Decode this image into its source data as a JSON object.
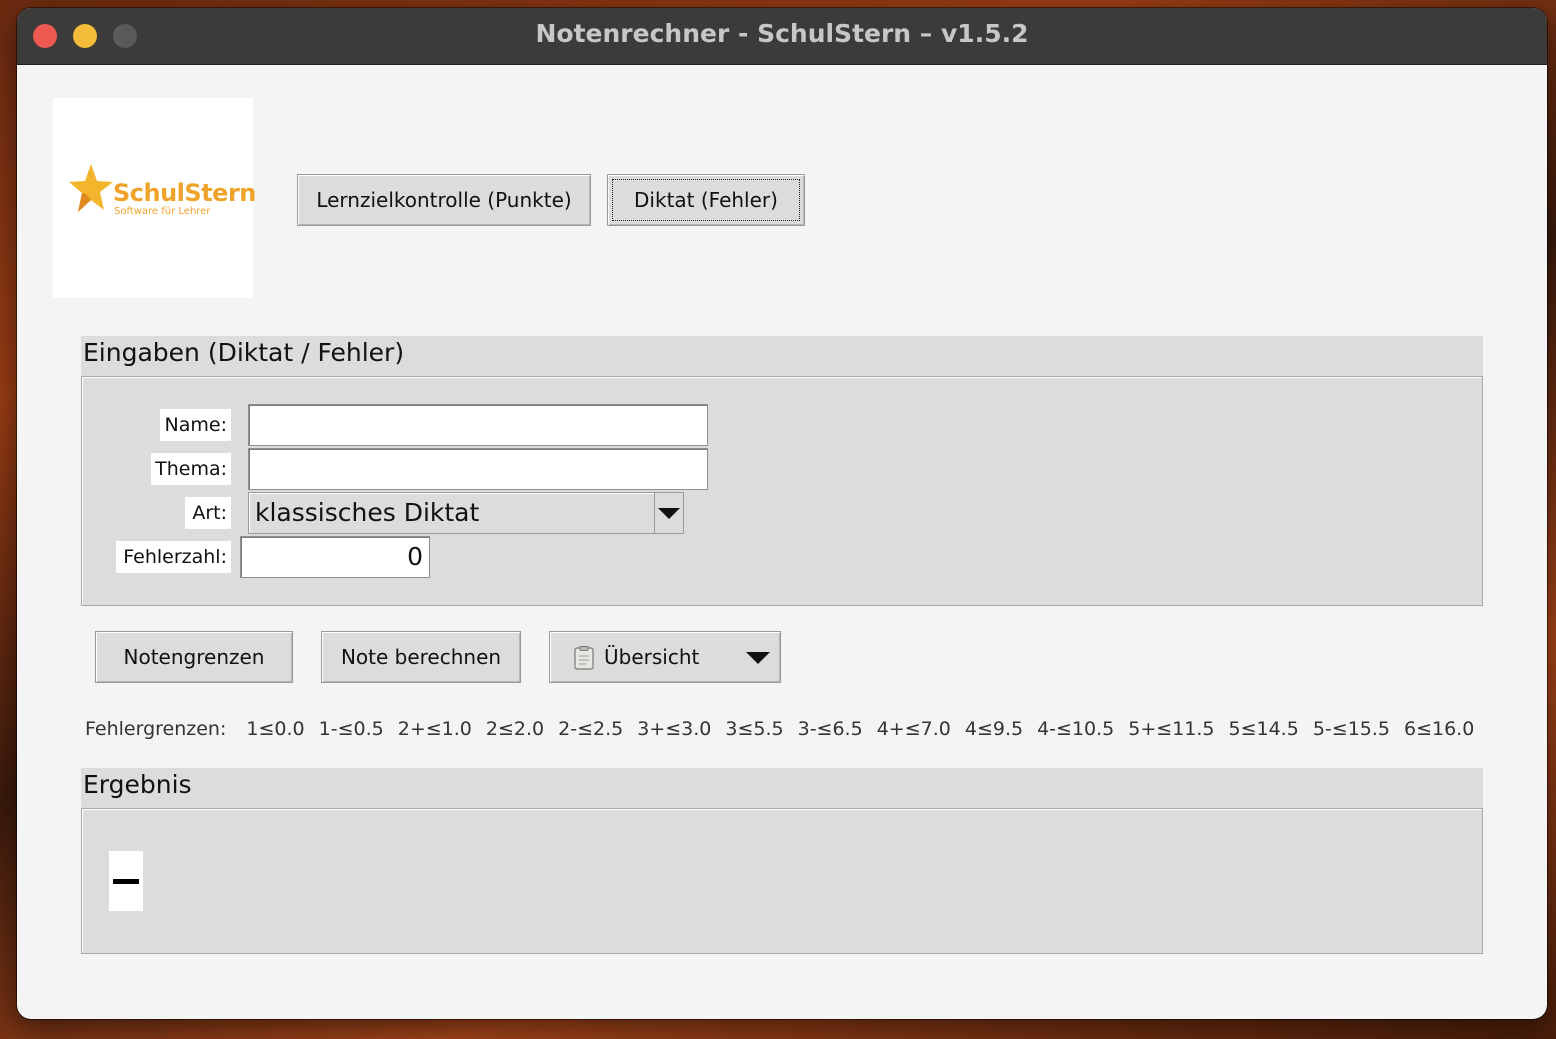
{
  "window": {
    "title": "Notenrechner - SchulStern  –  v1.5.2"
  },
  "logo": {
    "name": "SchulStern",
    "subtitle": "Software für Lehrer",
    "color": "#f0a32b"
  },
  "modes": {
    "lernziel_label": "Lernzielkontrolle (Punkte)",
    "diktat_label": "Diktat (Fehler)"
  },
  "inputs": {
    "header": "Eingaben (Diktat / Fehler)",
    "name_label": "Name:",
    "name_value": "",
    "thema_label": "Thema:",
    "thema_value": "",
    "art_label": "Art:",
    "art_value": "klassisches Diktat",
    "fehler_label": "Fehlerzahl:",
    "fehler_value": "0"
  },
  "actions": {
    "notengrenzen_label": "Notengrenzen",
    "berechnen_label": "Note berechnen",
    "uebersicht_label": "Übersicht"
  },
  "grenzen": {
    "label": "Fehlergrenzen:",
    "items": [
      "1≤0.0",
      "1-≤0.5",
      "2+≤1.0",
      "2≤2.0",
      "2-≤2.5",
      "3+≤3.0",
      "3≤5.5",
      "3-≤6.5",
      "4+≤7.0",
      "4≤9.5",
      "4-≤10.5",
      "5+≤11.5",
      "5≤14.5",
      "5-≤15.5",
      "6≤16.0"
    ]
  },
  "ergebnis": {
    "header": "Ergebnis"
  },
  "icons": {
    "star": "star-icon",
    "dropdown": "chevron-down-icon",
    "clipboard": "clipboard-icon"
  }
}
